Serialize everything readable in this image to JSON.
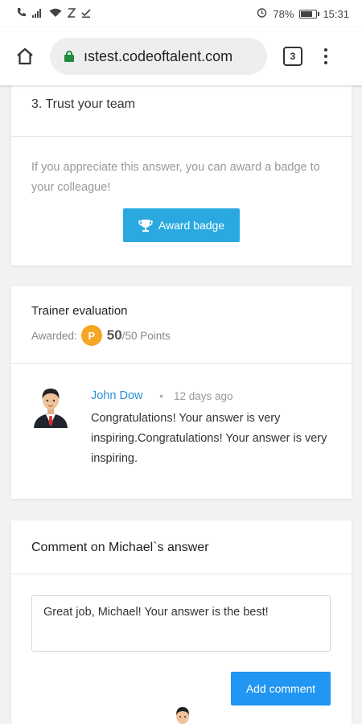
{
  "status_bar": {
    "battery": "78%",
    "battery_level": 0.78,
    "time": "15:31"
  },
  "browser": {
    "url": "ıstest.codeoftalent.com",
    "tab_count": "3"
  },
  "answer_card": {
    "trust_item": "3. Trust your team",
    "award_prompt": "If you appreciate this answer, you can award a badge to your colleague!",
    "award_button": "Award badge"
  },
  "evaluation": {
    "title": "Trainer evaluation",
    "awarded_label": "Awarded:",
    "badge_letter": "P",
    "points": "50",
    "points_suffix": "/50 Points"
  },
  "trainer_comment": {
    "author": "John Dow",
    "separator": "•",
    "time_ago": "12 days ago",
    "text": "Congratulations! Your answer is very inspiring.Congratulations! Your answer is very inspiring."
  },
  "comment_form": {
    "heading": "Comment on Michael`s answer",
    "input_value": "Great job, Michael! Your answer is the best!",
    "submit_button": "Add comment"
  },
  "colors": {
    "award_button": "#2aa9e0",
    "submit_button": "#2196f3",
    "author_link": "#2a8fd6",
    "points_badge": "#f5a623",
    "lock": "#1e8e3e"
  }
}
